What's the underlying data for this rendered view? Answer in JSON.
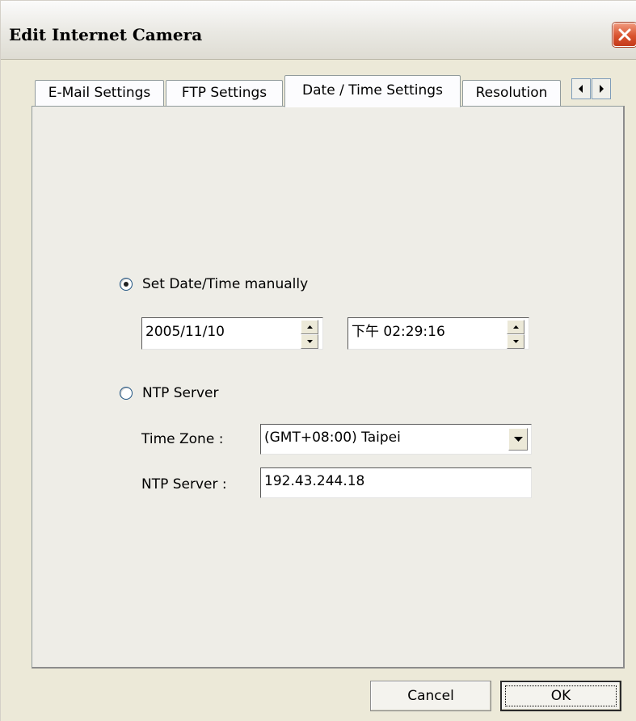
{
  "window": {
    "title": "Edit Internet Camera"
  },
  "tabs": [
    {
      "label": "E-Mail Settings",
      "active": false
    },
    {
      "label": "FTP Settings",
      "active": false
    },
    {
      "label": "Date / Time Settings",
      "active": true
    },
    {
      "label": "Resolution",
      "active": false
    }
  ],
  "manual": {
    "label": "Set Date/Time manually",
    "selected": true,
    "date_value": "2005/11/10",
    "time_value": "下午 02:29:16"
  },
  "ntp": {
    "label": "NTP Server",
    "selected": false,
    "timezone_label": "Time Zone :",
    "timezone_value": "(GMT+08:00) Taipei",
    "server_label": "NTP Server :",
    "server_value": "192.43.244.18"
  },
  "buttons": {
    "cancel": "Cancel",
    "ok": "OK"
  }
}
